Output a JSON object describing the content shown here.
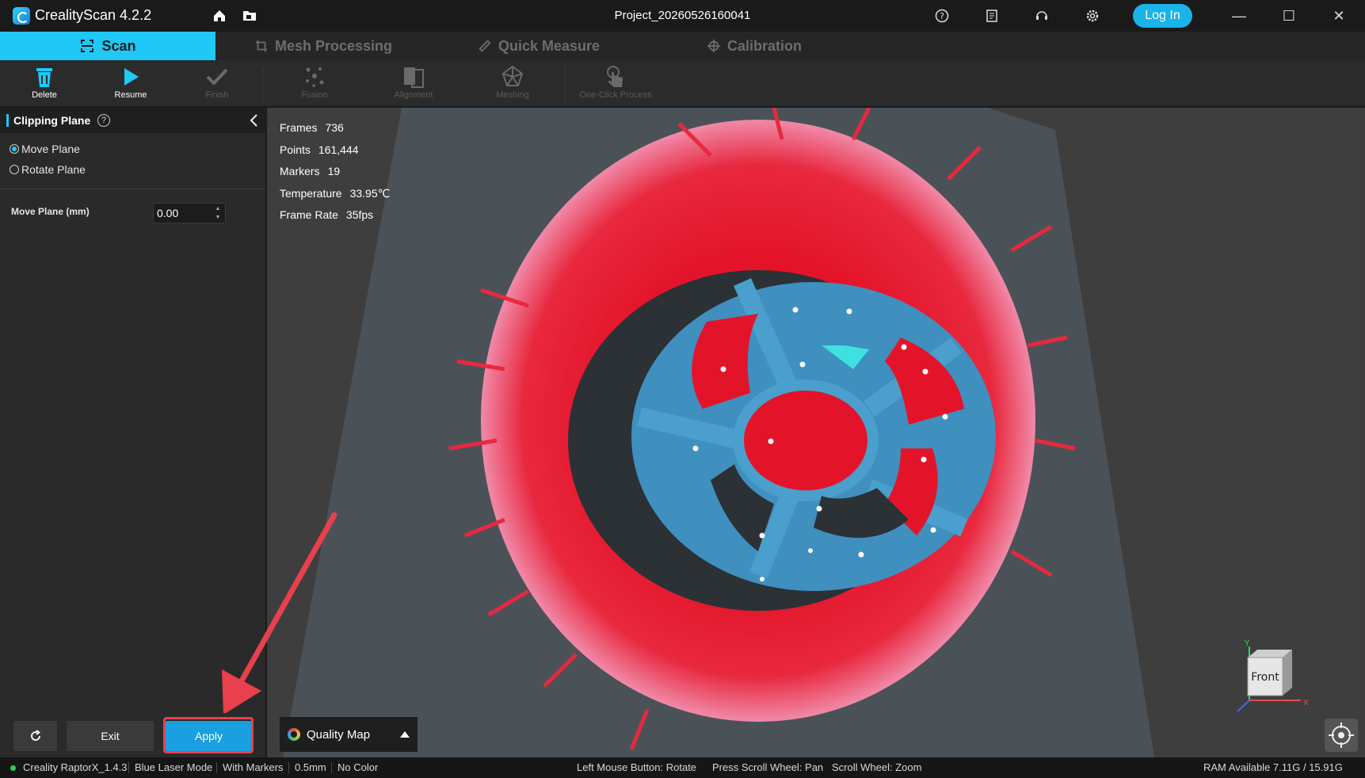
{
  "app": {
    "title": "CrealityScan 4.2.2",
    "project": "Project_20260526160041",
    "login_label": "Log In"
  },
  "titlebar_icons": [
    "home-icon",
    "folder-icon",
    "help-icon",
    "document-icon",
    "support-icon",
    "settings-icon"
  ],
  "tabs": [
    {
      "label": "Scan",
      "icon": "scan-icon",
      "active": true
    },
    {
      "label": "Mesh Processing",
      "icon": "crop-icon",
      "active": false
    },
    {
      "label": "Quick Measure",
      "icon": "ruler-icon",
      "active": false
    },
    {
      "label": "Calibration",
      "icon": "target-icon",
      "active": false
    }
  ],
  "toolbar": [
    {
      "label": "Delete",
      "icon": "trash-icon",
      "enabled": true
    },
    {
      "label": "Resume",
      "icon": "play-icon",
      "enabled": true
    },
    {
      "label": "Finish",
      "icon": "check-icon",
      "enabled": false
    },
    {
      "label": "Fusion",
      "icon": "fusion-icon",
      "enabled": false
    },
    {
      "label": "Alignment",
      "icon": "alignment-icon",
      "enabled": false
    },
    {
      "label": "Meshing",
      "icon": "meshing-icon",
      "enabled": false
    },
    {
      "label": "One-Click Process",
      "icon": "touch-icon",
      "enabled": false
    }
  ],
  "panel": {
    "title": "Clipping Plane",
    "options": [
      {
        "label": "Move Plane",
        "checked": true
      },
      {
        "label": "Rotate Plane",
        "checked": false
      }
    ],
    "field_label": "Move Plane (mm)",
    "field_value": "0.00",
    "exit_label": "Exit",
    "apply_label": "Apply"
  },
  "stats": [
    {
      "key": "Frames",
      "value": "736"
    },
    {
      "key": "Points",
      "value": "161,444"
    },
    {
      "key": "Markers",
      "value": "19"
    },
    {
      "key": "Temperature",
      "value": "33.95℃"
    },
    {
      "key": "Frame Rate",
      "value": "35fps"
    }
  ],
  "quality_map_label": "Quality Map",
  "view_cube": {
    "face": "Front",
    "axis_x": "X",
    "axis_y": "Y"
  },
  "statusbar": {
    "device": "Creality RaptorX_1.4.3",
    "mode": "Blue Laser Mode",
    "markers": "With Markers",
    "resolution": "0.5mm",
    "color": "No Color",
    "hint_rotate": "Left Mouse Button: Rotate",
    "hint_pan": "Press Scroll Wheel: Pan",
    "hint_zoom": "Scroll Wheel: Zoom",
    "ram": "RAM Available 7.11G / 15.91G"
  },
  "colors": {
    "accent": "#1fc8f5",
    "apply": "#1a9fe0",
    "highlight": "#e8404c",
    "scan_red": "#e81c2c",
    "scan_blue": "#3f8fbf"
  }
}
